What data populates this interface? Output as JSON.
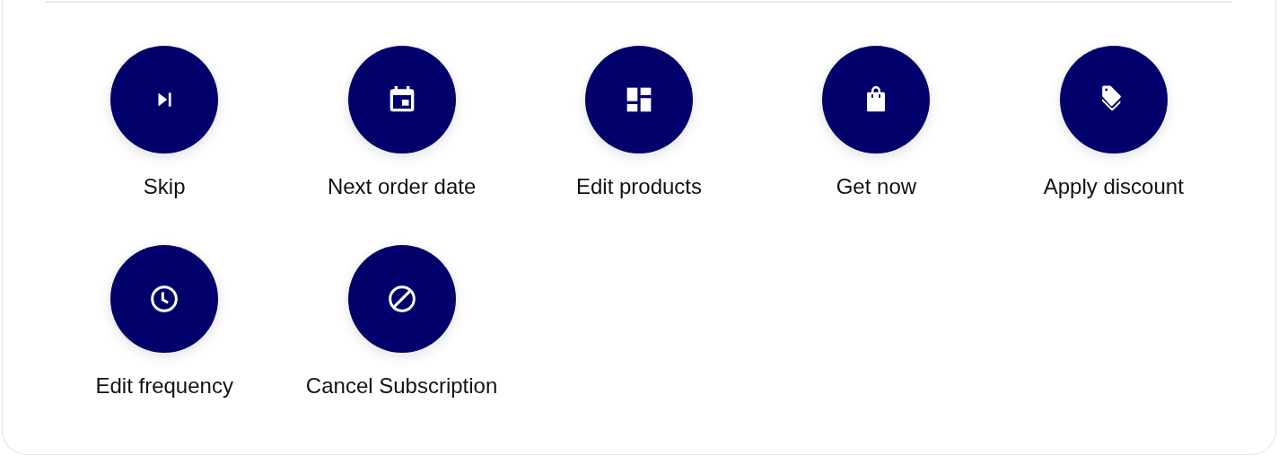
{
  "actions": [
    {
      "kind": "skip",
      "label": "Skip"
    },
    {
      "kind": "calendar",
      "label": "Next order date"
    },
    {
      "kind": "products",
      "label": "Edit products"
    },
    {
      "kind": "bag",
      "label": "Get now"
    },
    {
      "kind": "discount",
      "label": "Apply discount"
    },
    {
      "kind": "frequency",
      "label": "Edit frequency"
    },
    {
      "kind": "cancel",
      "label": "Cancel Subscription"
    }
  ]
}
